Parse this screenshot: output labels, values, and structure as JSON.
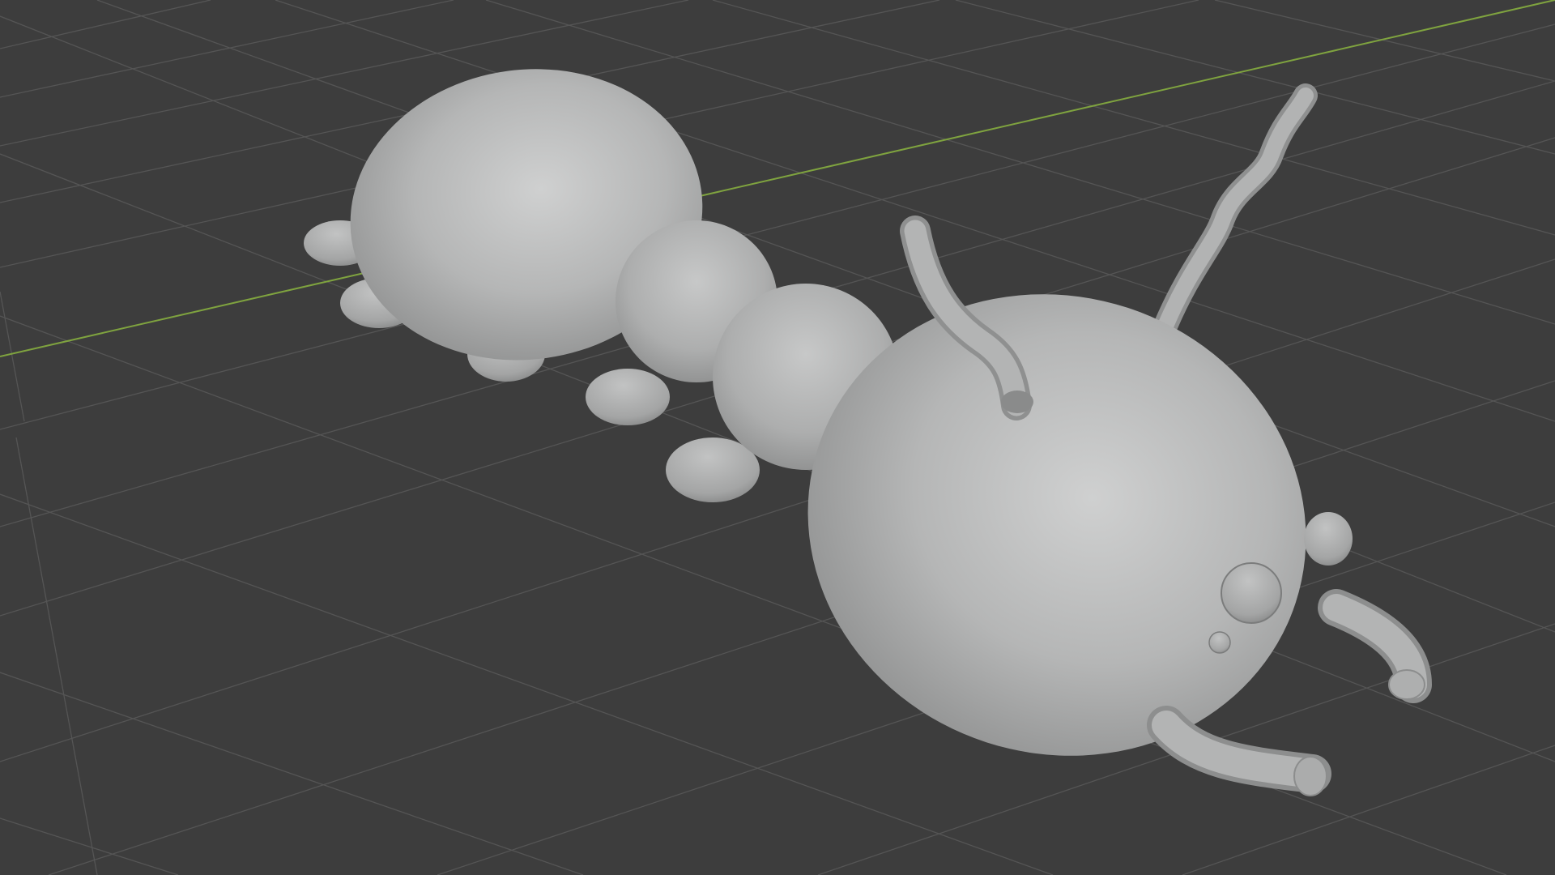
{
  "viewport": {
    "mode": "solid",
    "background": "#3d3d3d",
    "grid_color": "#555555",
    "x_axis_color": "#7fa33f",
    "model_color": "#b5b6b6"
  },
  "model": {
    "parts": [
      "rear-body",
      "middle-segment-1",
      "middle-segment-2",
      "head",
      "eye",
      "nostril",
      "ear-bump",
      "leg-front",
      "leg-rear",
      "tusk-upper",
      "tusk-lower",
      "antenna-short",
      "antenna-long"
    ]
  }
}
